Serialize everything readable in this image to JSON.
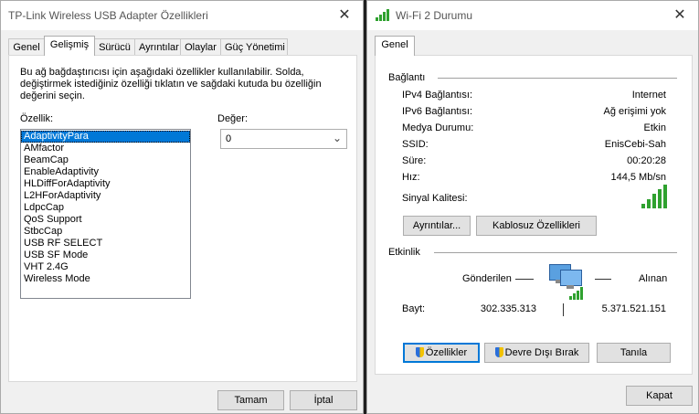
{
  "left_window": {
    "title": "TP-Link Wireless USB Adapter Özellikleri",
    "tabs": [
      "Genel",
      "Gelişmiş",
      "Sürücü",
      "Ayrıntılar",
      "Olaylar",
      "Güç Yönetimi"
    ],
    "active_tab": "Gelişmiş",
    "description": "Bu ağ bağdaştırıcısı için aşağıdaki özellikler kullanılabilir. Solda, değiştirmek istediğiniz özelliği tıklatın ve sağdaki kutuda bu özelliğin değerini seçin.",
    "property_label": "Özellik:",
    "properties": [
      "AdaptivityPara",
      "AMfactor",
      "BeamCap",
      "EnableAdaptivity",
      "HLDiffForAdaptivity",
      "L2HForAdaptivity",
      "LdpcCap",
      "QoS Support",
      "StbcCap",
      "USB RF SELECT",
      "USB SF Mode",
      "VHT 2.4G",
      "Wireless Mode"
    ],
    "selected_property": "AdaptivityPara",
    "value_label": "Değer:",
    "value": "0",
    "ok_label": "Tamam",
    "cancel_label": "İptal"
  },
  "right_window": {
    "title": "Wi-Fi 2 Durumu",
    "tab": "Genel",
    "connection_section": "Bağlantı",
    "rows": [
      {
        "label": "IPv4 Bağlantısı:",
        "value": "Internet"
      },
      {
        "label": "IPv6 Bağlantısı:",
        "value": "Ağ erişimi yok"
      },
      {
        "label": "Medya Durumu:",
        "value": "Etkin"
      },
      {
        "label": "SSID:",
        "value": "EnisCebi-Sah"
      },
      {
        "label": "Süre:",
        "value": "00:20:28"
      },
      {
        "label": "Hız:",
        "value": "144,5 Mb/sn"
      }
    ],
    "signal_label": "Sinyal Kalitesi:",
    "signal_bars": 5,
    "details_button": "Ayrıntılar...",
    "wireless_props_button": "Kablosuz Özellikleri",
    "activity_section": "Etkinlik",
    "sent_label": "Gönderilen",
    "received_label": "Alınan",
    "bytes_label": "Bayt:",
    "bytes_sent": "302.335.313",
    "bytes_received": "5.371.521.151",
    "properties_button": "Özellikler",
    "disable_button": "Devre Dışı Bırak",
    "diagnose_button": "Tanıla",
    "close_button": "Kapat",
    "colors": {
      "signal": "#2fa12f",
      "accent": "#0078d7"
    }
  }
}
